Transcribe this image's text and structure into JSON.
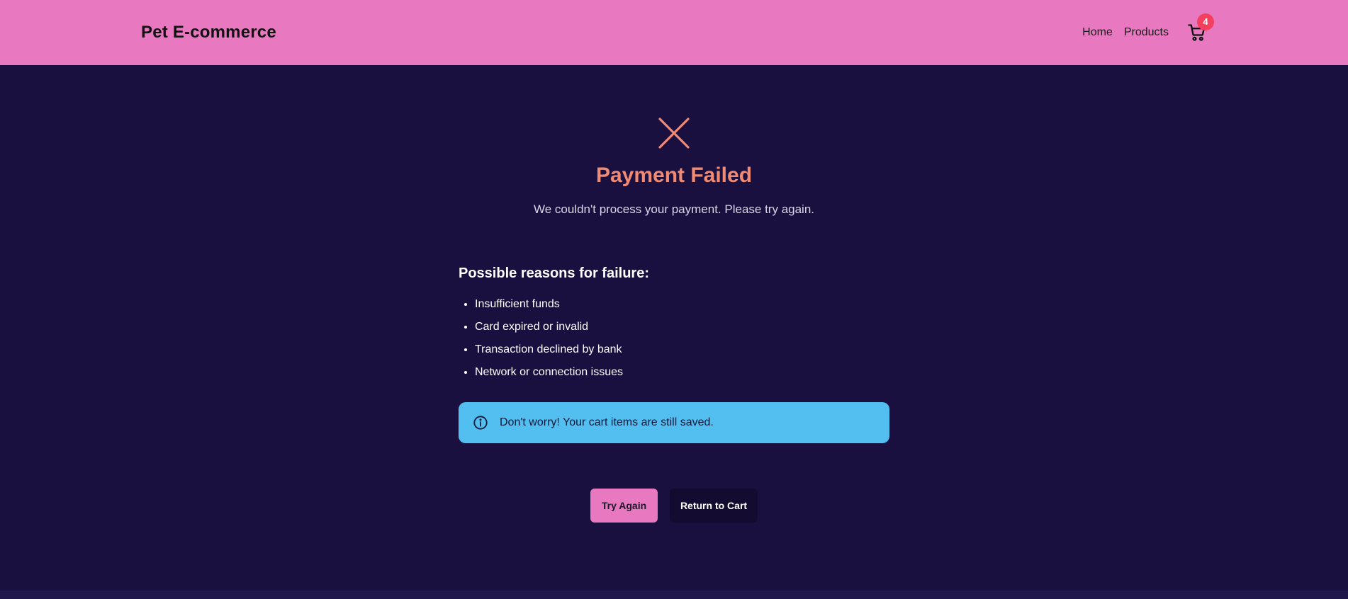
{
  "navbar": {
    "brand": "Pet E-commerce",
    "links": [
      "Home",
      "Products"
    ],
    "cart_icon": "shopping-cart-icon",
    "cart_count": "4",
    "background_color": "#e879c0",
    "badge_color": "#f43f5e"
  },
  "status": {
    "icon": "x-close-icon",
    "title": "Payment Failed",
    "message": "We couldn't process your payment. Please try again.",
    "accent_color": "#f08a73"
  },
  "reasons": {
    "heading": "Possible reasons for failure:",
    "items": [
      "Insufficient funds",
      "Card expired or invalid",
      "Transaction declined by bank",
      "Network or connection issues"
    ]
  },
  "notice": {
    "icon": "info-circle-icon",
    "text": "Don't worry! Your cart items are still saved.",
    "background_color": "#52bff0"
  },
  "actions": {
    "try_again_label": "Try Again",
    "return_to_cart_label": "Return to Cart"
  },
  "theme": {
    "page_background": "#1a1040"
  }
}
